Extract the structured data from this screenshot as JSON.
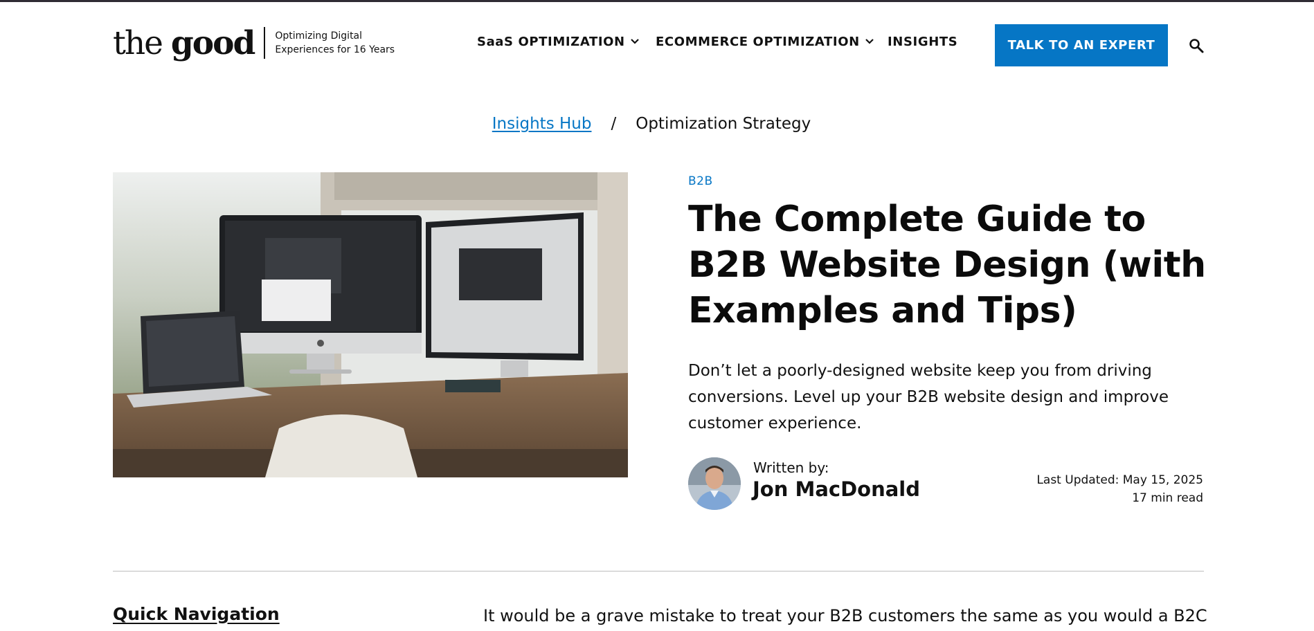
{
  "header": {
    "logo": {
      "word_light": "the ",
      "word_bold": "good",
      "tagline": "Optimizing Digital Experiences for 16 Years"
    },
    "nav": [
      {
        "label": "SaaS OPTIMIZATION",
        "has_dropdown": true
      },
      {
        "label": "ECOMMERCE OPTIMIZATION",
        "has_dropdown": true
      },
      {
        "label": "INSIGHTS",
        "has_dropdown": false
      }
    ],
    "cta_label": "TALK TO AN EXPERT",
    "search_icon": "search-icon",
    "accent_color": "#0676c5"
  },
  "breadcrumb": {
    "link": "Insights Hub",
    "separator": "/",
    "current": "Optimization Strategy"
  },
  "article": {
    "category": "B2B",
    "title": "The Complete Guide to B2B Website Design (with Examples and Tips)",
    "lede": "Don’t let a poorly-designed website keep you from driving conversions. Level up your B2B website design and improve customer experience.",
    "written_by_label": "Written by:",
    "author": "Jon MacDonald",
    "last_updated": "Last Updated: May 15, 2025",
    "read_time": "17 min read",
    "intro_text": "It would be a grave mistake to treat your B2B customers the same as you would a B2C"
  },
  "sidebar": {
    "quick_nav_label": "Quick Navigation"
  }
}
